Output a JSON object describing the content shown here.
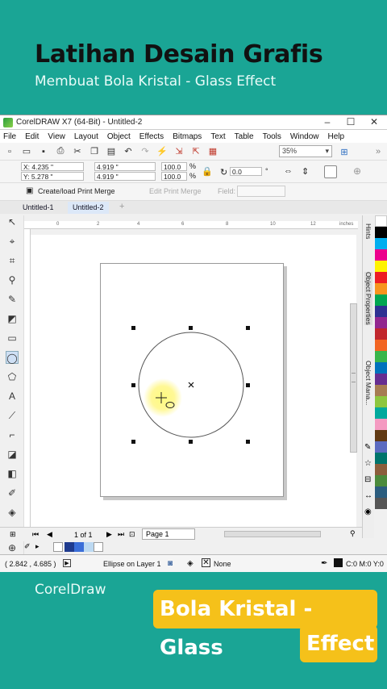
{
  "header": {
    "title": "Latihan Desain Grafis",
    "subtitle": "Membuat Bola Kristal - Glass Effect"
  },
  "window": {
    "title": "CorelDRAW X7 (64-Bit) - Untitled-2"
  },
  "menu": [
    "File",
    "Edit",
    "View",
    "Layout",
    "Object",
    "Effects",
    "Bitmaps",
    "Text",
    "Table",
    "Tools",
    "Window",
    "Help"
  ],
  "toolbar": {
    "zoom": "35%"
  },
  "propbar": {
    "x": "X: 4.235 \"",
    "y": "Y: 5.278 \"",
    "w": "4.919 \"",
    "h": "4.919 \"",
    "sx": "100.0",
    "sy": "100.0",
    "pct": "%",
    "angle": "0.0",
    "deg": "°"
  },
  "mergebar": {
    "create": "Create/load Print Merge",
    "edit": "Edit Print Merge",
    "field": "Field:"
  },
  "tabs": [
    "Untitled-1",
    "Untitled-2"
  ],
  "ruler": {
    "units": "inches",
    "marks": [
      "0",
      "2",
      "4",
      "6",
      "8",
      "10",
      "12"
    ]
  },
  "right_panel": {
    "hints": "Hints",
    "object_properties": "Object Properties",
    "object_manager": "Object Mana..."
  },
  "page_nav": {
    "counter": "1 of 1",
    "page_tab": "Page 1"
  },
  "status": {
    "coords": "( 2.842 , 4.685 )",
    "info": "Ellipse on Layer 1",
    "fill": "None",
    "outline": "C:0 M:0 Y:0"
  },
  "footer": {
    "left": "CorelDraw",
    "badge_line1": "Bola Kristal - Glass",
    "badge_line2": "Effect"
  },
  "colors": {
    "brand_bg": "#1aa595",
    "badge": "#f5c11a"
  }
}
